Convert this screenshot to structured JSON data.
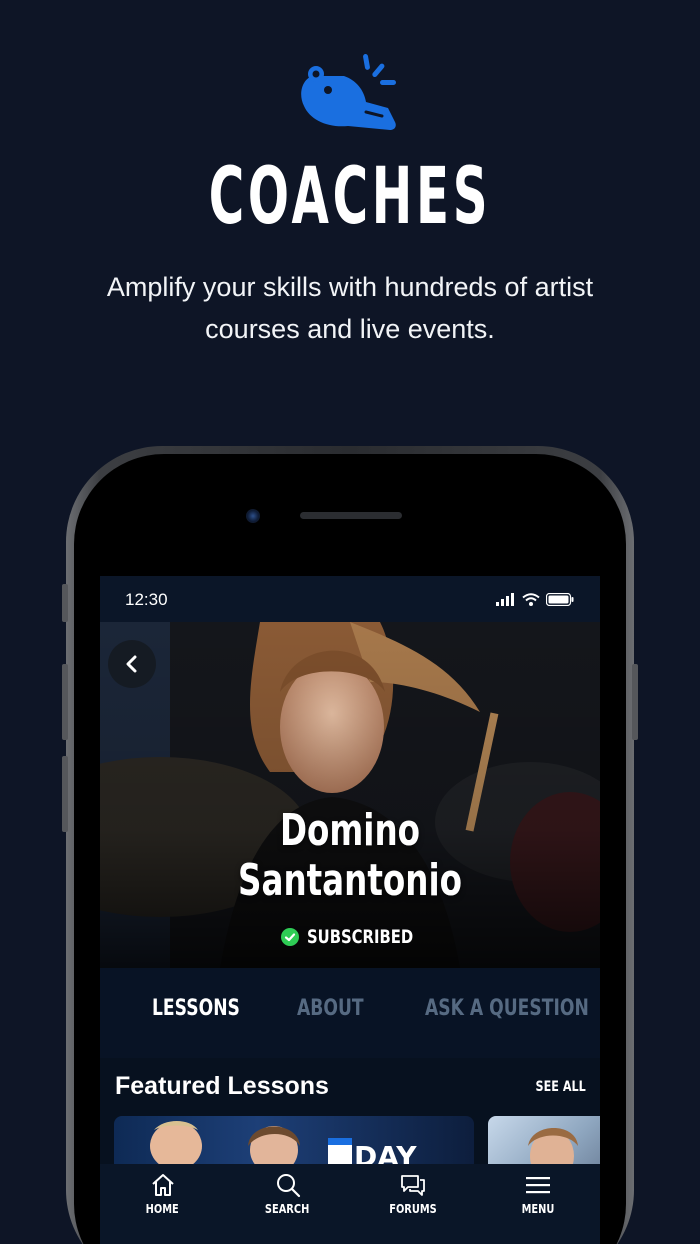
{
  "hero": {
    "title": "COACHES",
    "subtitle": "Amplify your skills with hundreds of artist courses and live events.",
    "icon": "whistle-icon",
    "accent_color": "#1a6fe0"
  },
  "status_bar": {
    "time": "12:30",
    "icons": [
      "signal-icon",
      "wifi-icon",
      "battery-icon"
    ]
  },
  "coach": {
    "name_line1": "Domino",
    "name_line2": "Santantonio",
    "status": "SUBSCRIBED",
    "status_color": "#2ecc55"
  },
  "tabs": [
    {
      "label": "LESSONS",
      "active": true
    },
    {
      "label": "ABOUT",
      "active": false
    },
    {
      "label": "ASK A QUESTION",
      "active": false
    }
  ],
  "featured": {
    "title": "Featured Lessons",
    "see_all": "SEE ALL",
    "card1_text": "DAY"
  },
  "nav": [
    {
      "label": "HOME",
      "icon": "home-icon"
    },
    {
      "label": "SEARCH",
      "icon": "search-icon"
    },
    {
      "label": "FORUMS",
      "icon": "forums-icon"
    },
    {
      "label": "MENU",
      "icon": "menu-icon"
    }
  ]
}
